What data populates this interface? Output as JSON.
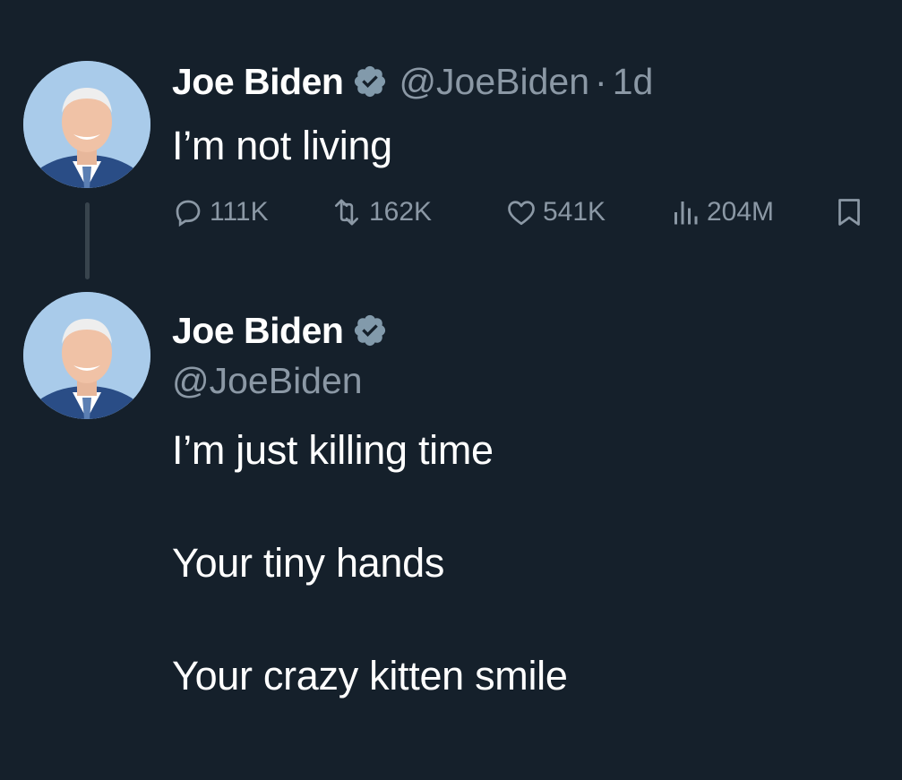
{
  "colors": {
    "background": "#15202b",
    "primary_text": "#ffffff",
    "secondary_text": "#8b98a5",
    "thread_line": "#38444d",
    "verified_badge": "#829aab"
  },
  "tweets": [
    {
      "author": {
        "name": "Joe Biden",
        "handle": "@JoeBiden",
        "verified_icon": "verified-badge-icon",
        "avatar": "avatar-photo"
      },
      "separator": "·",
      "time": "1d",
      "text": "I’m not living",
      "actions": {
        "reply": {
          "icon": "reply-icon",
          "count": "111K"
        },
        "retweet": {
          "icon": "retweet-icon",
          "count": "162K"
        },
        "like": {
          "icon": "heart-icon",
          "count": "541K"
        },
        "views": {
          "icon": "views-chart-icon",
          "count": "204M"
        },
        "bookmark": {
          "icon": "bookmark-icon"
        }
      }
    },
    {
      "author": {
        "name": "Joe Biden",
        "handle": "@JoeBiden",
        "verified_icon": "verified-badge-icon",
        "avatar": "avatar-photo"
      },
      "lines": [
        "I’m just killing time",
        "Your tiny hands",
        "Your crazy kitten smile"
      ]
    }
  ]
}
